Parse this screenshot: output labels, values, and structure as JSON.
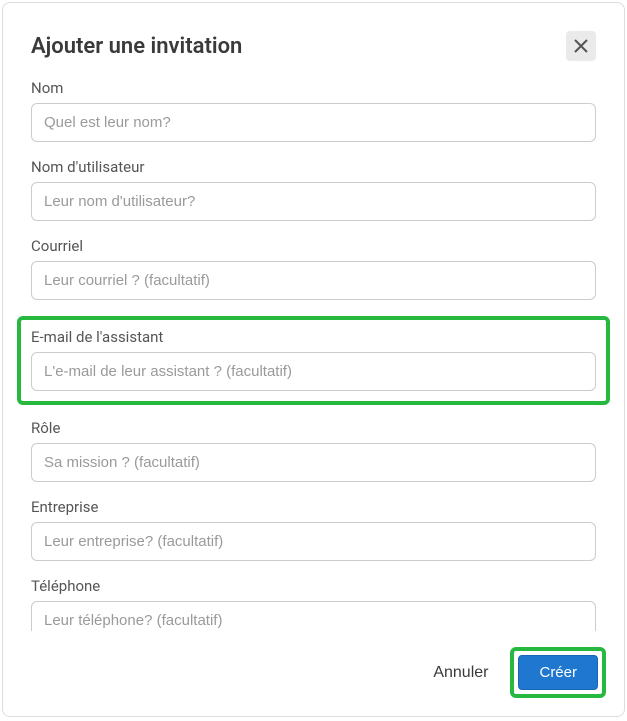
{
  "modal": {
    "title": "Ajouter une invitation"
  },
  "fields": {
    "name": {
      "label": "Nom",
      "placeholder": "Quel est leur nom?"
    },
    "username": {
      "label": "Nom d'utilisateur",
      "placeholder": "Leur nom d'utilisateur?"
    },
    "email": {
      "label": "Courriel",
      "placeholder": "Leur courriel ? (facultatif)"
    },
    "assistant_email": {
      "label": "E-mail de l'assistant",
      "placeholder": "L'e-mail de leur assistant ? (facultatif)"
    },
    "role": {
      "label": "Rôle",
      "placeholder": "Sa mission ? (facultatif)"
    },
    "company": {
      "label": "Entreprise",
      "placeholder": "Leur entreprise? (facultatif)"
    },
    "phone": {
      "label": "Téléphone",
      "placeholder": "Leur téléphone? (facultatif)"
    }
  },
  "footer": {
    "cancel": "Annuler",
    "create": "Créer"
  }
}
